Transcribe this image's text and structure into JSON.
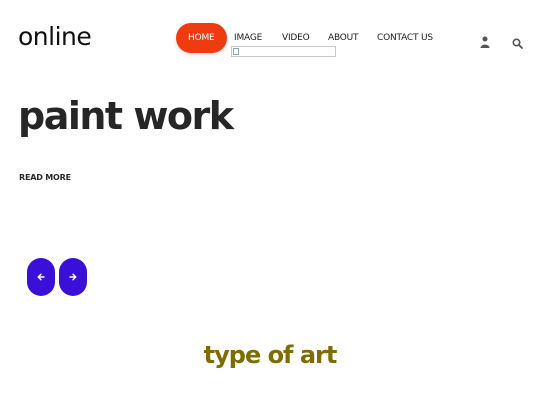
{
  "header": {
    "logo_text": "online",
    "nav": {
      "home": "HOME",
      "image": "IMAGE",
      "video": "VIDEO",
      "about": "ABOUT",
      "contact": "CONTACT US"
    },
    "icons": {
      "user": "user-icon",
      "search": "search-icon"
    },
    "accent_color": "#ee3b0f"
  },
  "hero": {
    "title": "paint work",
    "read_more": "READ MORE",
    "slider_color": "#3a10d8"
  },
  "section": {
    "title": "type of art",
    "title_color": "#7d6d05"
  }
}
